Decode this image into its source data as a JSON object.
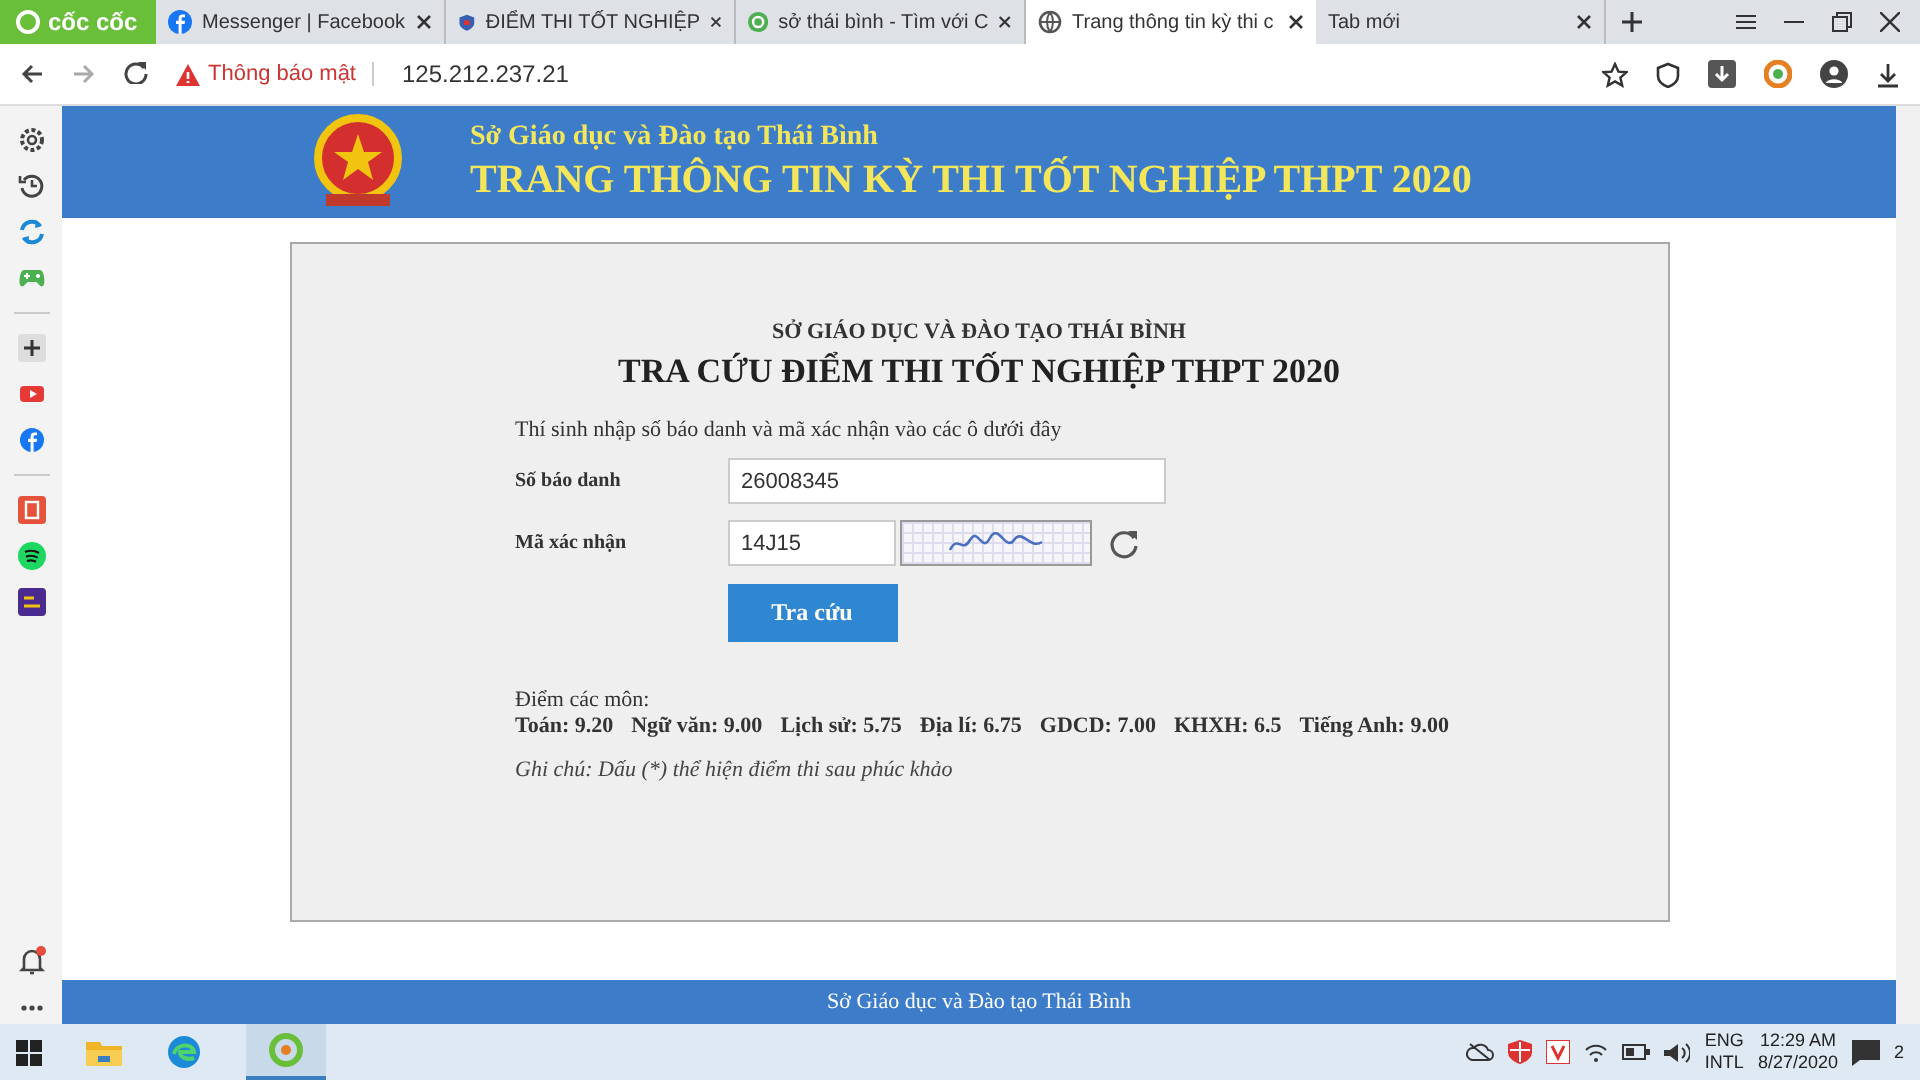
{
  "browser": {
    "brand": "cốc cốc",
    "tabs": [
      {
        "label": "Messenger | Facebook",
        "selected": false
      },
      {
        "label": "ĐIỂM THI TỐT NGHIỆP",
        "selected": false
      },
      {
        "label": "sở thái bình - Tìm với C",
        "selected": false
      },
      {
        "label": "Trang thông tin kỳ thi c",
        "selected": true
      },
      {
        "label": "Tab mới",
        "selected": false
      }
    ],
    "security_label": "Thông báo mật",
    "url": "125.212.237.21"
  },
  "sidebar": {
    "items": [
      {
        "kind": "gear"
      },
      {
        "kind": "history"
      },
      {
        "kind": "sync"
      },
      {
        "kind": "game"
      },
      {
        "kind": "sep"
      },
      {
        "kind": "plus"
      },
      {
        "kind": "youtube"
      },
      {
        "kind": "facebook"
      },
      {
        "kind": "sep"
      },
      {
        "kind": "app"
      },
      {
        "kind": "spotify"
      },
      {
        "kind": "promo"
      }
    ]
  },
  "header": {
    "subtitle": "Sở Giáo dục và Đào tạo Thái Bình",
    "title": "TRANG THÔNG TIN KỲ THI TỐT NGHIỆP THPT 2020"
  },
  "form": {
    "agency": "SỞ GIÁO DỤC VÀ ĐÀO TẠO THÁI BÌNH",
    "title": "TRA CỨU ĐIỂM THI TỐT NGHIỆP THPT 2020",
    "instruction": "Thí sinh nhập số báo danh và mã xác nhận vào các ô dưới đây",
    "id_label": "Số báo danh",
    "id_value": "26008345",
    "code_label": "Mã xác nhận",
    "code_value": "14J15",
    "submit": "Tra cứu",
    "scores_heading": "Điểm các môn:",
    "scores": [
      {
        "subject": "Toán:",
        "score": "9.20"
      },
      {
        "subject": "Ngữ văn:",
        "score": "9.00"
      },
      {
        "subject": "Lịch sử:",
        "score": "5.75"
      },
      {
        "subject": "Địa lí:",
        "score": "6.75"
      },
      {
        "subject": "GDCD:",
        "score": "7.00"
      },
      {
        "subject": "KHXH:",
        "score": "6.5"
      },
      {
        "subject": "Tiếng Anh:",
        "score": "9.00"
      }
    ],
    "note": "Ghi chú: Dấu (*) thể hiện điểm thi sau phúc khảo"
  },
  "footer": {
    "text": "Sở Giáo dục và Đào tạo Thái Bình"
  },
  "taskbar": {
    "language": "ENG",
    "layout": "INTL",
    "time": "12:29 AM",
    "date": "8/27/2020",
    "notifications": "2"
  }
}
